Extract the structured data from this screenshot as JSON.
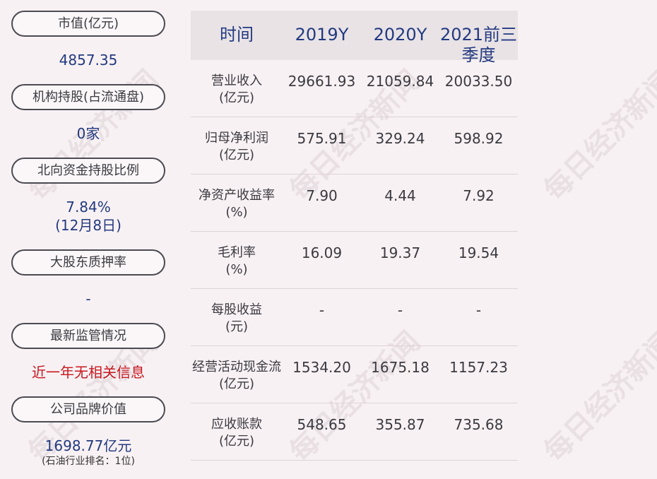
{
  "left": {
    "items": [
      {
        "label": "市值(亿元)",
        "value": "4857.35"
      },
      {
        "label": "机构持股(占流通盘)",
        "value": "0家"
      },
      {
        "label": "北向资金持股比例",
        "value": "7.84%",
        "value2": "(12月8日)"
      },
      {
        "label": "大股东质押率",
        "value": "-"
      },
      {
        "label": "最新监管情况",
        "value": "近一年无相关信息"
      },
      {
        "label": "公司品牌价值",
        "value": "1698.77亿元",
        "note": "(石油行业排名：1位)"
      }
    ]
  },
  "table": {
    "headers": [
      "时间",
      "2019Y",
      "2020Y",
      "2021前三季度"
    ],
    "rows": [
      {
        "label1": "营业收入",
        "label2": "(亿元)",
        "values": [
          "29661.93",
          "21059.84",
          "20033.50"
        ]
      },
      {
        "label1": "归母净利润",
        "label2": "(亿元)",
        "values": [
          "575.91",
          "329.24",
          "598.92"
        ]
      },
      {
        "label1": "净资产收益率",
        "label2": "(%)",
        "values": [
          "7.90",
          "4.44",
          "7.92"
        ]
      },
      {
        "label1": "毛利率",
        "label2": "(%)",
        "values": [
          "16.09",
          "19.37",
          "19.54"
        ]
      },
      {
        "label1": "每股收益",
        "label2": "(元)",
        "values": [
          "-",
          "-",
          "-"
        ]
      },
      {
        "label1": "经营活动现金流",
        "label2": "(亿元)",
        "values": [
          "1534.20",
          "1675.18",
          "1157.23"
        ]
      },
      {
        "label1": "应收账款",
        "label2": "(亿元)",
        "values": [
          "548.65",
          "355.87",
          "735.68"
        ]
      }
    ]
  },
  "watermark": "每日经济新闻"
}
